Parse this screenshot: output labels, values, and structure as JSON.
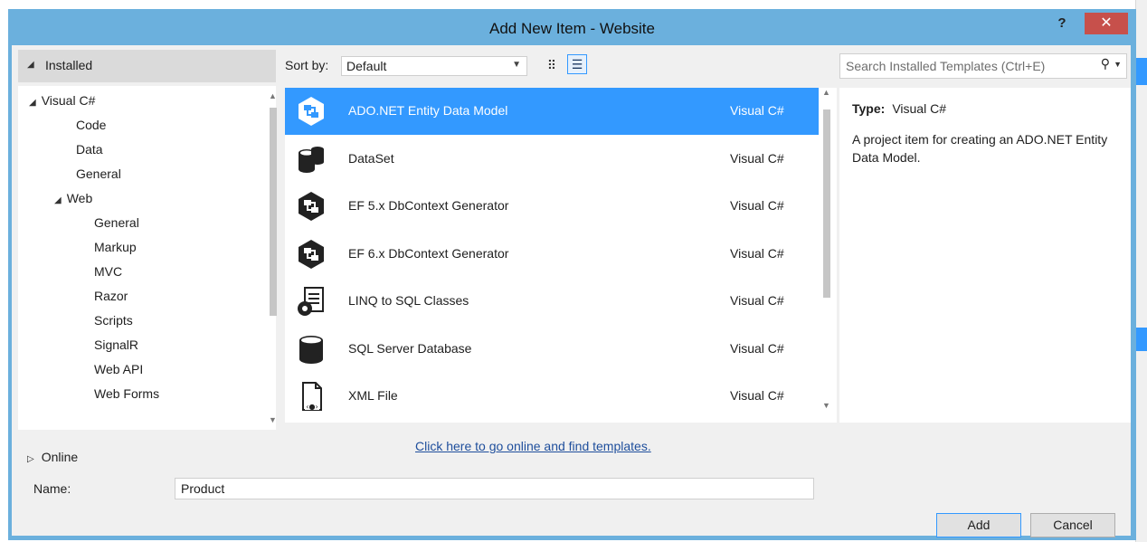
{
  "window": {
    "title": "Add New Item - Website",
    "help_label": "?",
    "close_label": "✕"
  },
  "left_pane": {
    "installed_label": "Installed",
    "tree": [
      {
        "label": "Visual C#",
        "level": 0,
        "expanded": true
      },
      {
        "label": "Code",
        "level": 1
      },
      {
        "label": "Data",
        "level": 1,
        "selected": true
      },
      {
        "label": "General",
        "level": 1
      },
      {
        "label": "Web",
        "level": 1,
        "expanded": true
      },
      {
        "label": "General",
        "level": 2
      },
      {
        "label": "Markup",
        "level": 2
      },
      {
        "label": "MVC",
        "level": 2
      },
      {
        "label": "Razor",
        "level": 2
      },
      {
        "label": "Scripts",
        "level": 2
      },
      {
        "label": "SignalR",
        "level": 2
      },
      {
        "label": "Web API",
        "level": 2
      },
      {
        "label": "Web Forms",
        "level": 2
      }
    ],
    "online_label": "Online"
  },
  "toolbar": {
    "sort_label": "Sort by:",
    "sort_value": "Default"
  },
  "templates": [
    {
      "name": "ADO.NET Entity Data Model",
      "type": "Visual C#",
      "icon": "entity-model-icon",
      "selected": true
    },
    {
      "name": "DataSet",
      "type": "Visual C#",
      "icon": "dataset-icon"
    },
    {
      "name": "EF 5.x DbContext Generator",
      "type": "Visual C#",
      "icon": "ef-generator-icon"
    },
    {
      "name": "EF 6.x DbContext Generator",
      "type": "Visual C#",
      "icon": "ef-generator-icon"
    },
    {
      "name": "LINQ to SQL Classes",
      "type": "Visual C#",
      "icon": "linq-classes-icon"
    },
    {
      "name": "SQL Server Database",
      "type": "Visual C#",
      "icon": "database-icon"
    },
    {
      "name": "XML File",
      "type": "Visual C#",
      "icon": "xml-file-icon"
    }
  ],
  "online_link": "Click here to go online and find templates.",
  "search": {
    "placeholder": "Search Installed Templates (Ctrl+E)"
  },
  "details": {
    "type_label": "Type:",
    "type_value": "Visual C#",
    "description": "A project item for creating an ADO.NET Entity Data Model."
  },
  "name_field": {
    "label": "Name:",
    "value": "Product"
  },
  "buttons": {
    "add": "Add",
    "cancel": "Cancel"
  },
  "colors": {
    "frame": "#6bb0dd",
    "selection": "#3399ff",
    "close": "#c7504b",
    "link": "#1e4e9c"
  }
}
